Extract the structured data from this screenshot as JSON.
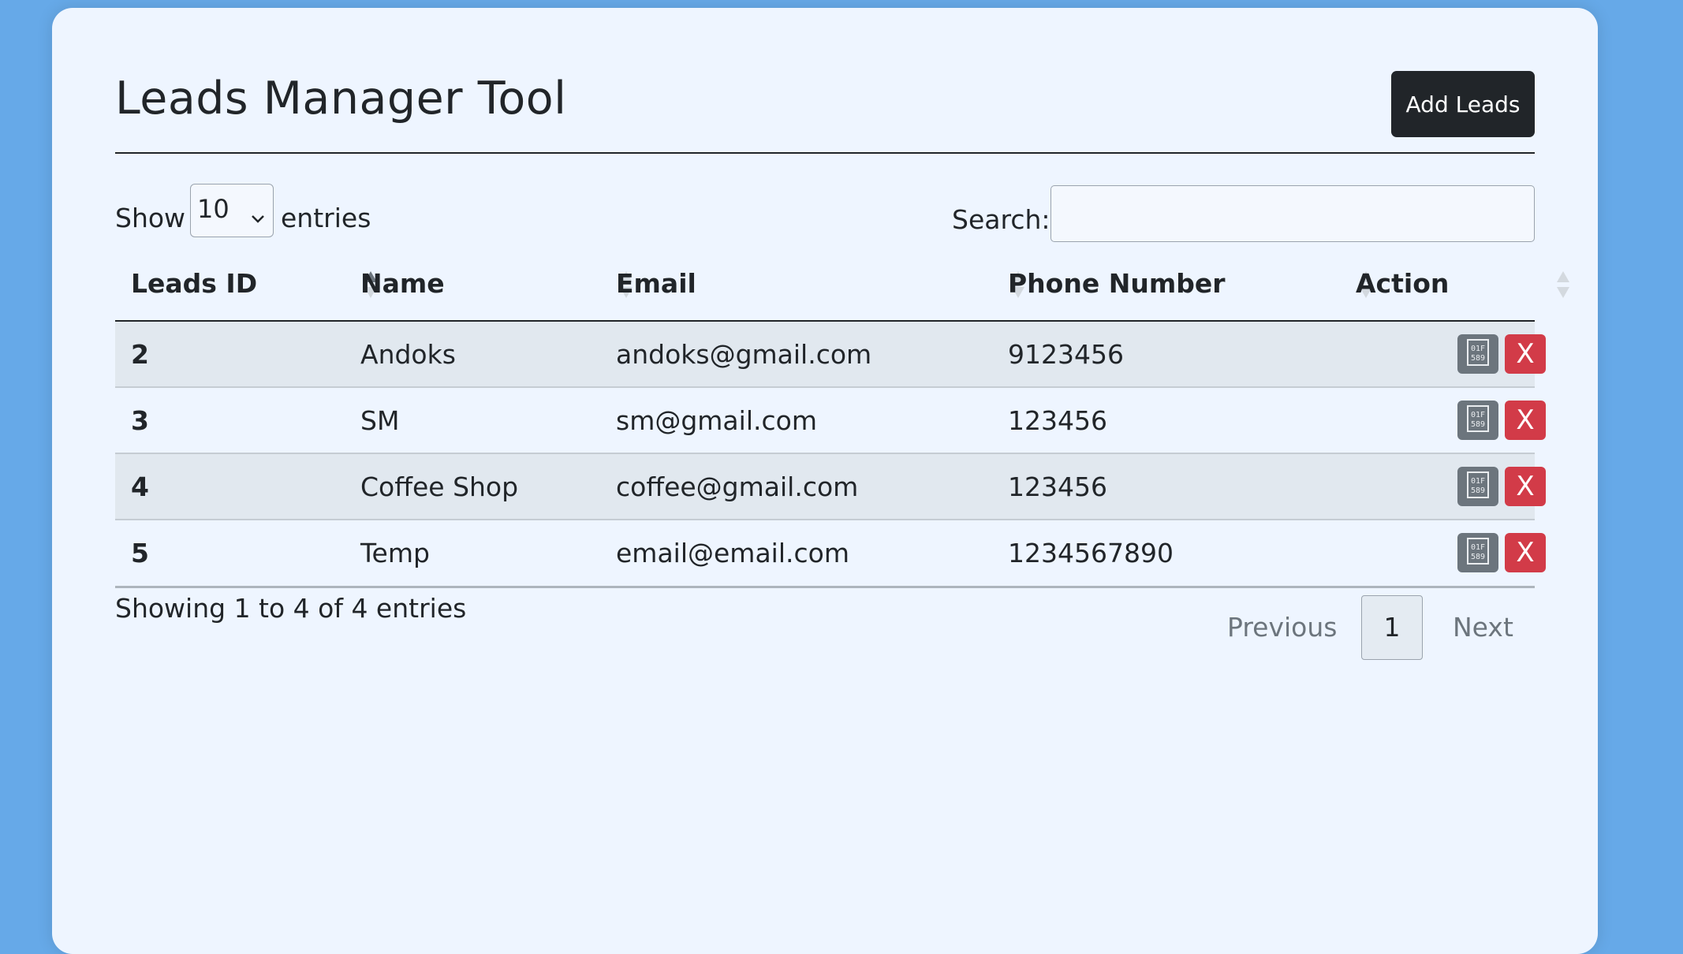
{
  "header": {
    "title": "Leads Manager Tool",
    "add_label": "Add Leads"
  },
  "length": {
    "prefix": "Show",
    "value": "10",
    "suffix": "entries"
  },
  "search": {
    "label": "Search:",
    "value": "",
    "placeholder": ""
  },
  "columns": [
    "Leads ID",
    "Name",
    "Email",
    "Phone Number",
    "Action"
  ],
  "rows": [
    {
      "id": "2",
      "name": "Andoks",
      "email": "andoks@gmail.com",
      "phone": "9123456"
    },
    {
      "id": "3",
      "name": "SM",
      "email": "sm@gmail.com",
      "phone": "123456"
    },
    {
      "id": "4",
      "name": "Coffee Shop",
      "email": "coffee@gmail.com",
      "phone": "123456"
    },
    {
      "id": "5",
      "name": "Temp",
      "email": "email@email.com",
      "phone": "1234567890"
    }
  ],
  "actions": {
    "edit_icon": "edit-icon",
    "delete_label": "X"
  },
  "footer": {
    "info": "Showing 1 to 4 of 4 entries"
  },
  "pagination": {
    "previous": "Previous",
    "page": "1",
    "next": "Next"
  },
  "colors": {
    "background": "#66a9e8",
    "card": "#eef5ff",
    "primary_dark": "#212529",
    "danger": "#d23b48",
    "secondary": "#6c757d"
  }
}
